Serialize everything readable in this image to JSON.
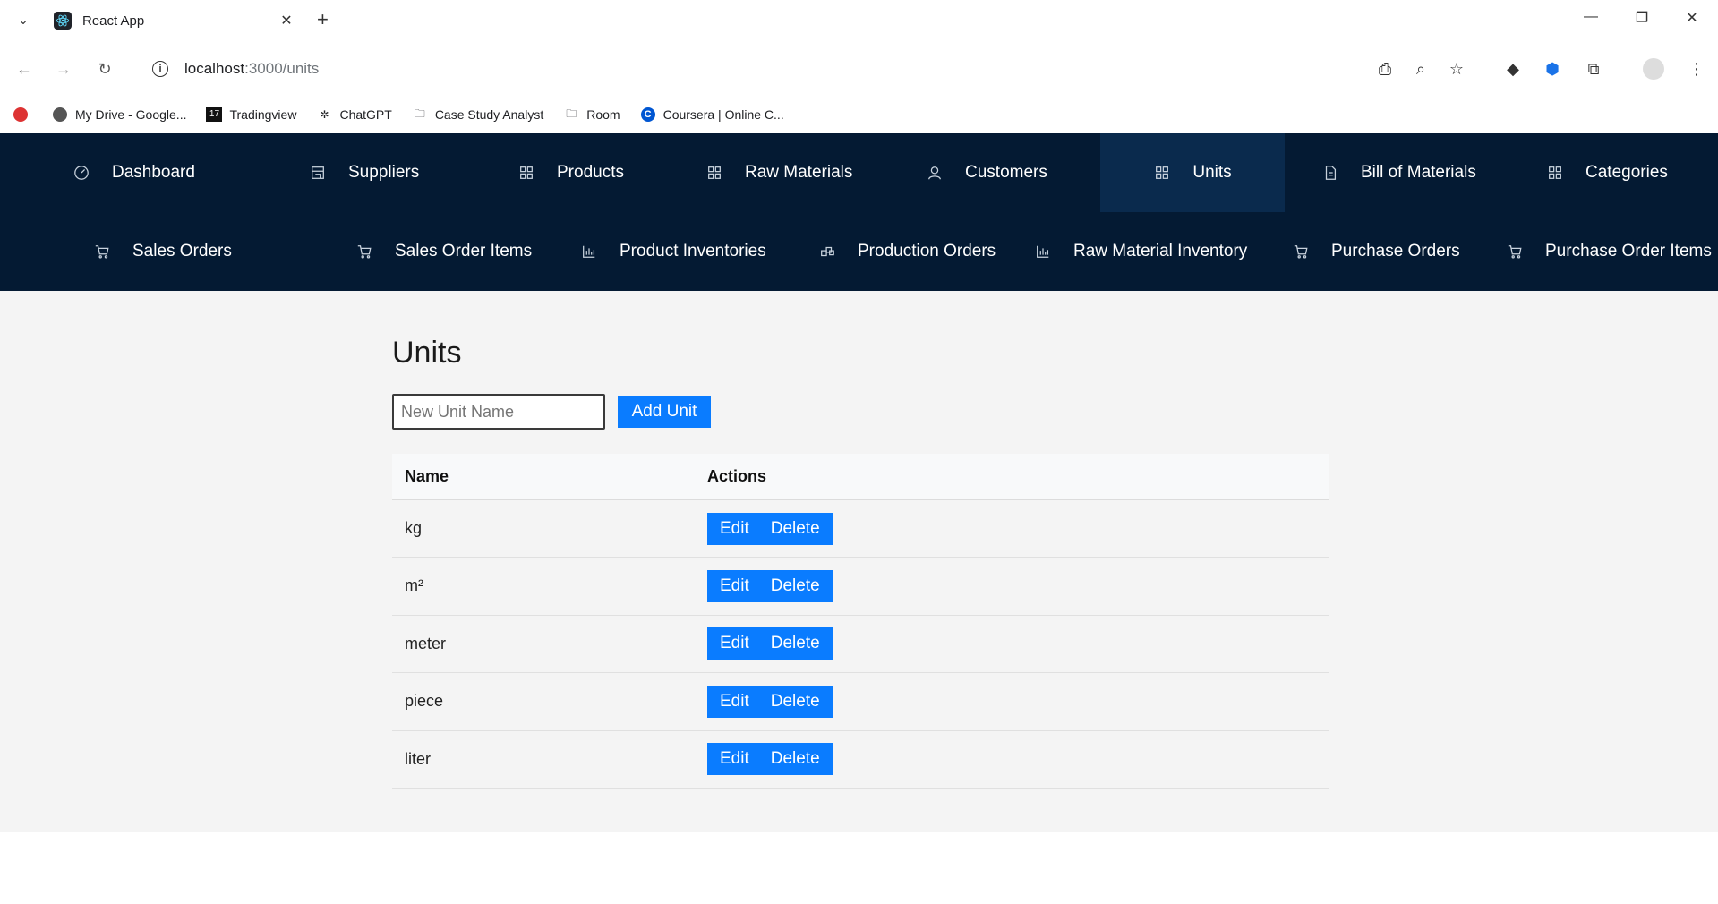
{
  "browser": {
    "tab_title": "React App",
    "url_host": "localhost",
    "url_path": ":3000/units",
    "bookmarks": [
      {
        "label": "My Drive - Google..."
      },
      {
        "label": "Tradingview"
      },
      {
        "label": "ChatGPT"
      },
      {
        "label": "Case Study Analyst"
      },
      {
        "label": "Room"
      },
      {
        "label": "Coursera | Online C..."
      }
    ]
  },
  "nav": {
    "row1": [
      {
        "label": "Dashboard",
        "icon": "dashboard-icon"
      },
      {
        "label": "Suppliers",
        "icon": "store-icon"
      },
      {
        "label": "Products",
        "icon": "grid-icon"
      },
      {
        "label": "Raw Materials",
        "icon": "grid-icon"
      },
      {
        "label": "Customers",
        "icon": "user-icon"
      },
      {
        "label": "Units",
        "icon": "grid-icon",
        "active": true
      },
      {
        "label": "Bill of Materials",
        "icon": "document-icon"
      },
      {
        "label": "Categories",
        "icon": "grid-icon"
      }
    ],
    "row2": [
      {
        "label": "Sales Orders",
        "icon": "cart-icon"
      },
      {
        "label": "Sales Order Items",
        "icon": "cart-icon"
      },
      {
        "label": "Product Inventories",
        "icon": "bar-chart-icon"
      },
      {
        "label": "Production Orders",
        "icon": "blocks-icon"
      },
      {
        "label": "Raw Material Inventory",
        "icon": "bar-chart-icon"
      },
      {
        "label": "Purchase Orders",
        "icon": "cart-icon"
      },
      {
        "label": "Purchase Order Items",
        "icon": "cart-icon"
      }
    ]
  },
  "page": {
    "title": "Units",
    "input_placeholder": "New Unit Name",
    "add_button": "Add Unit",
    "table": {
      "headers": [
        "Name",
        "Actions"
      ],
      "rows": [
        {
          "name": "kg"
        },
        {
          "name": "m²"
        },
        {
          "name": "meter"
        },
        {
          "name": "piece"
        },
        {
          "name": "liter"
        }
      ],
      "edit_label": "Edit",
      "delete_label": "Delete"
    }
  },
  "colors": {
    "navbar_bg": "#041a33",
    "active_nav_bg": "#0a2a4d",
    "primary_button": "#0a7cff",
    "content_bg": "#f4f4f4"
  }
}
